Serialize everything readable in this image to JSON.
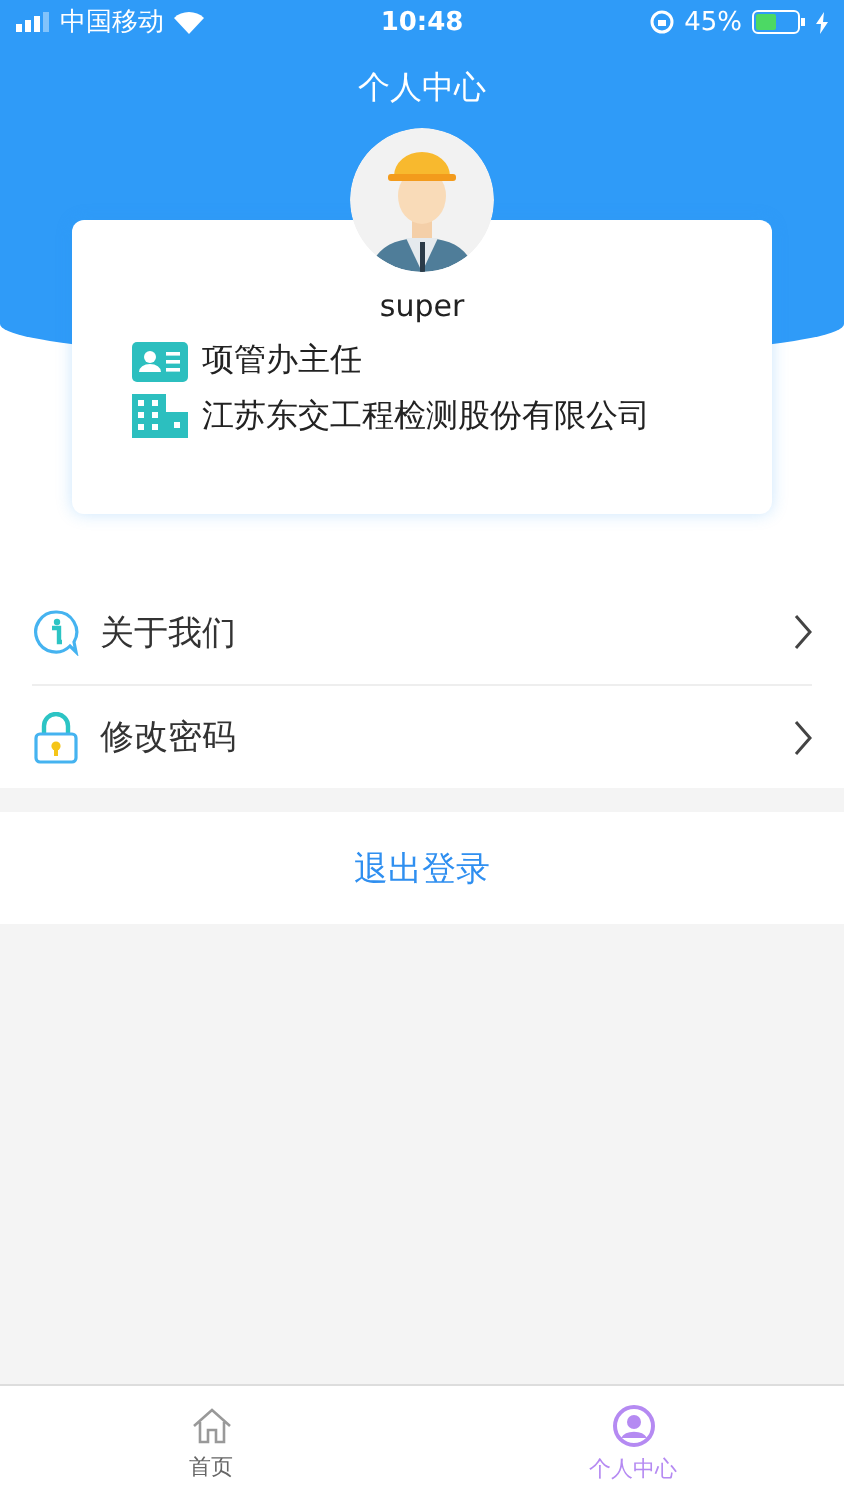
{
  "status_bar": {
    "carrier": "中国移动",
    "time": "10:48",
    "battery": "45%"
  },
  "header": {
    "title": "个人中心"
  },
  "profile": {
    "username": "super",
    "role": "项管办主任",
    "company": "江苏东交工程检测股份有限公司"
  },
  "menu": [
    {
      "label": "关于我们",
      "kind": "about"
    },
    {
      "label": "修改密码",
      "kind": "password"
    }
  ],
  "logout_button": "退出登录",
  "tab_bar": [
    {
      "label": "首页",
      "kind": "home",
      "selected": false
    },
    {
      "label": "个人中心",
      "kind": "profile",
      "selected": true
    }
  ]
}
